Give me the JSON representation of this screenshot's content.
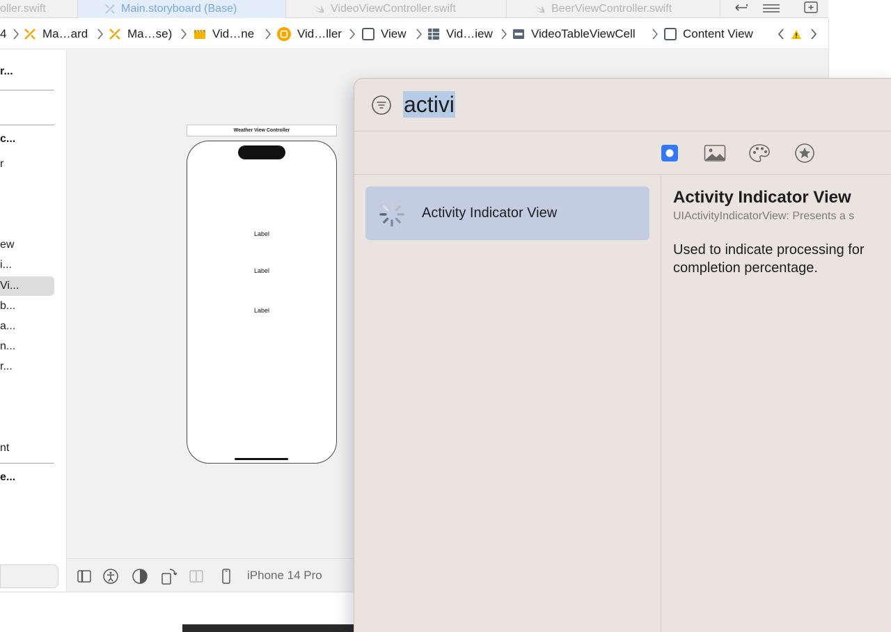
{
  "tabs": [
    {
      "label": "oller.swift",
      "active": false
    },
    {
      "label": "Main.storyboard (Base)",
      "active": true
    },
    {
      "label": "VideoViewController.swift",
      "active": false
    },
    {
      "label": "BeerViewController.swift",
      "active": false
    }
  ],
  "jumpbar": {
    "crumbs": [
      "4",
      "Ma…ard",
      "Ma…se)",
      "Vid…ne",
      "Vid…ller",
      "View",
      "Vid…iew",
      "VideoTableViewCell",
      "Content View"
    ]
  },
  "outline": {
    "items": [
      "r...",
      "c...",
      "r",
      "ew",
      "i...",
      "Vi...",
      "b...",
      "a...",
      "n...",
      "r...",
      "nt",
      "e..."
    ]
  },
  "canvas": {
    "scene_title": "Weather View Controller",
    "labels": [
      "Label",
      "Label",
      "Label"
    ],
    "device": "iPhone 14 Pro"
  },
  "library": {
    "search_value": "activi",
    "results": [
      {
        "label": "Activity Indicator View"
      }
    ],
    "detail": {
      "title": "Activity Indicator View",
      "class_line": "UIActivityIndicatorView: Presents a s",
      "description": "Used to indicate processing for completion percentage."
    }
  },
  "colors": {
    "accent": "#3478f6",
    "selection": "#c3cde2",
    "warning": "#f5c400"
  }
}
